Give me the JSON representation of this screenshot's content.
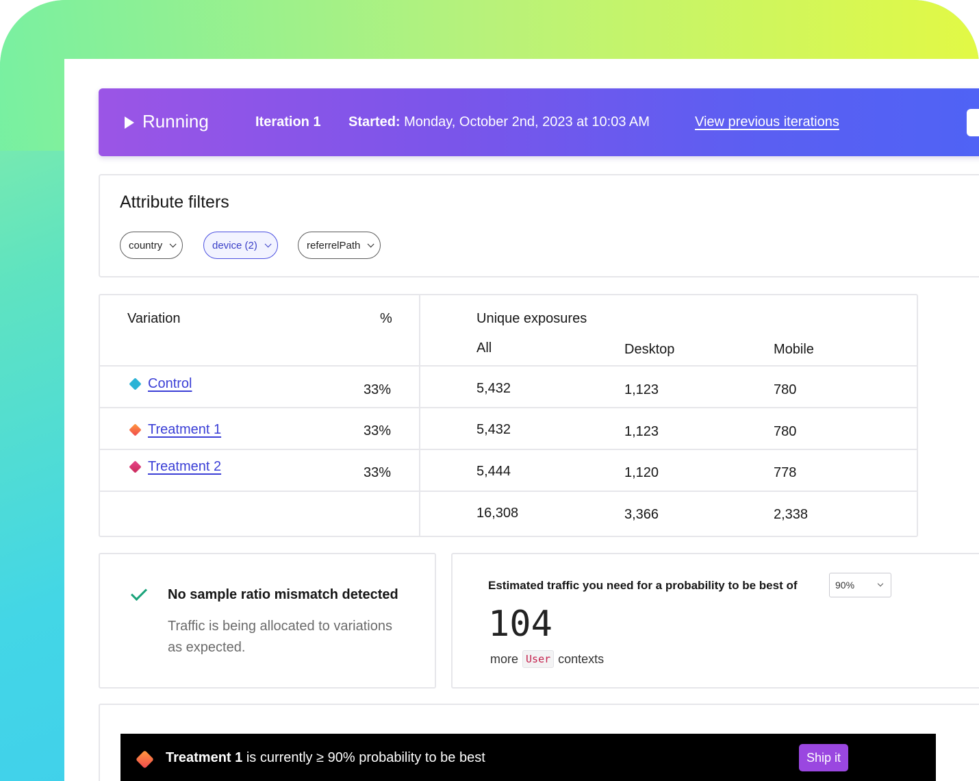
{
  "status": {
    "state": "Running",
    "iteration": "Iteration 1",
    "started_label": "Started:",
    "started_value": "Monday, October 2nd, 2023 at 10:03 AM",
    "previous_link": "View previous iterations"
  },
  "filters": {
    "title": "Attribute filters",
    "chips": [
      {
        "label": "country",
        "active": false
      },
      {
        "label": "device (2)",
        "active": true
      },
      {
        "label": "referrelPath",
        "active": false
      }
    ]
  },
  "exposures": {
    "variation_header": "Variation",
    "percent_header": "%",
    "group_header": "Unique exposures",
    "columns": [
      "All",
      "Desktop",
      "Mobile"
    ],
    "rows": [
      {
        "name": "Control",
        "percent": "33%",
        "all": "5,432",
        "desktop": "1,123",
        "mobile": "780",
        "color": "#2bb3d6"
      },
      {
        "name": "Treatment 1",
        "percent": "33%",
        "all": "5,432",
        "desktop": "1,123",
        "mobile": "780",
        "color": "#f2683f"
      },
      {
        "name": "Treatment 2",
        "percent": "33%",
        "all": "5,444",
        "desktop": "1,120",
        "mobile": "778",
        "color": "#d6336c"
      }
    ],
    "totals": {
      "all": "16,308",
      "desktop": "3,366",
      "mobile": "2,338"
    }
  },
  "srm": {
    "title": "No sample ratio mismatch detected",
    "description": "Traffic is being allocated to variations as expected."
  },
  "traffic": {
    "label": "Estimated traffic you need for a probability to be best of",
    "probability": "90%",
    "number": "104",
    "more": "more",
    "context_kind": "User",
    "contexts": "contexts"
  },
  "banner": {
    "winner": "Treatment 1",
    "text": "is currently ≥ 90% probability to be best",
    "ship_label": "Ship it"
  },
  "colors": {
    "accent": "#4f63f5",
    "link": "#3b3fd6",
    "success": "#1aa37a",
    "ship": "#9a47e0"
  }
}
